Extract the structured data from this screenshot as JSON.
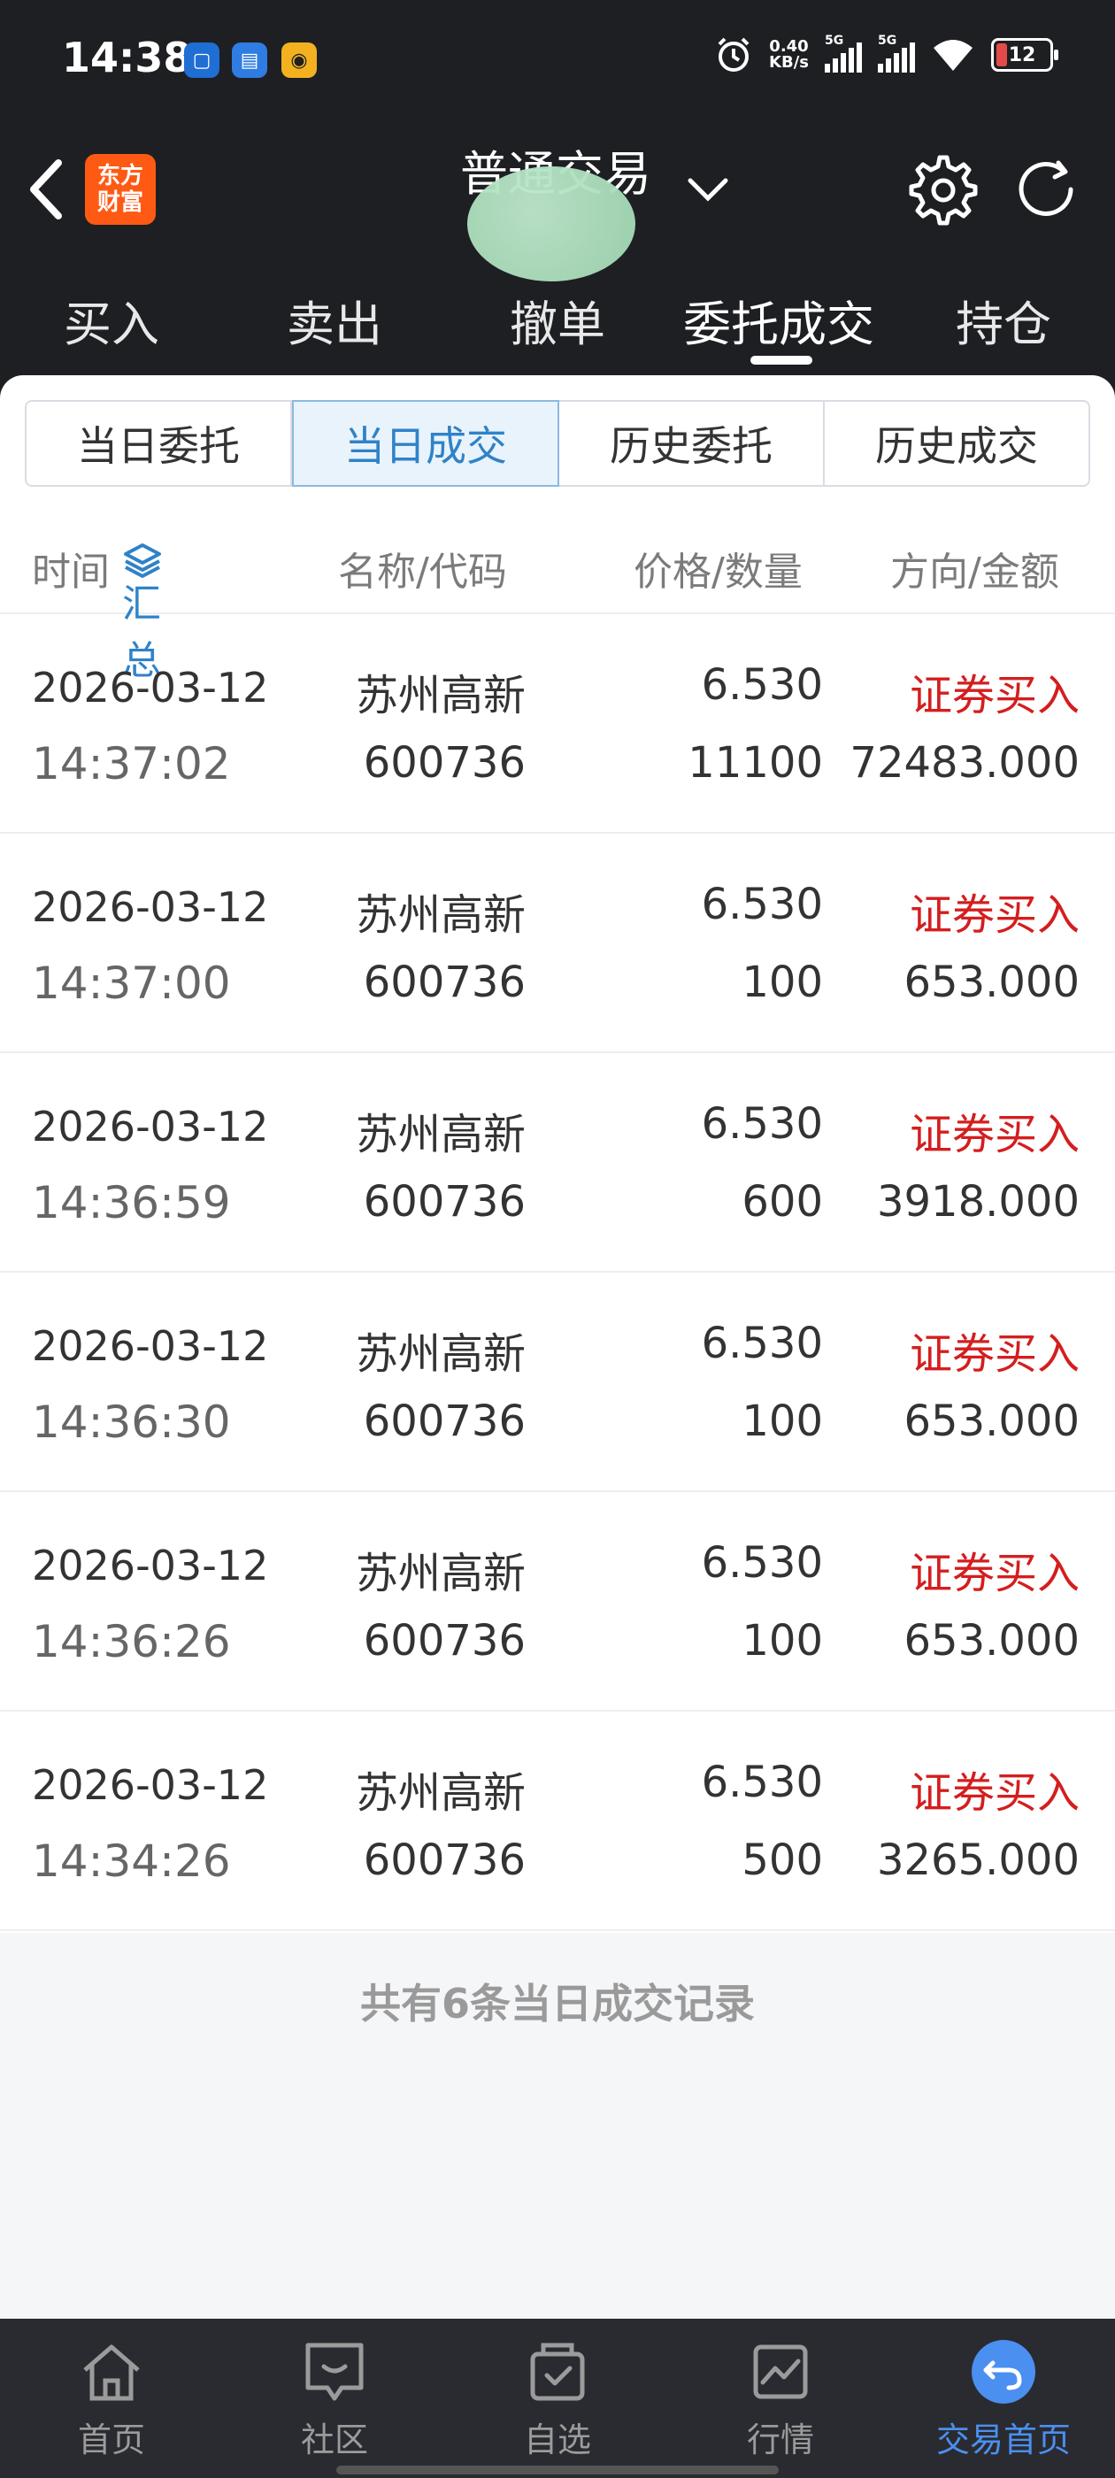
{
  "status": {
    "time": "14:38",
    "net_speed_top": "0.40",
    "net_speed_bottom": "KB/s",
    "signal1_label": "5G",
    "signal2_label": "5G",
    "battery": "12"
  },
  "header": {
    "logo_line1": "东方",
    "logo_line2": "财富",
    "title": "普通交易"
  },
  "top_tabs": [
    "买入",
    "卖出",
    "撤单",
    "委托成交",
    "持仓"
  ],
  "sub_tabs": [
    "当日委托",
    "当日成交",
    "历史委托",
    "历史成交"
  ],
  "columns": {
    "time": "时间",
    "summary": "汇总",
    "name_code": "名称/代码",
    "price_qty": "价格/数量",
    "dir_amount": "方向/金额"
  },
  "rows": [
    {
      "date": "2026-03-12",
      "time": "14:37:02",
      "name": "苏州高新",
      "code": "600736",
      "price": "6.530",
      "qty": "11100",
      "dir": "证券买入",
      "amount": "72483.000"
    },
    {
      "date": "2026-03-12",
      "time": "14:37:00",
      "name": "苏州高新",
      "code": "600736",
      "price": "6.530",
      "qty": "100",
      "dir": "证券买入",
      "amount": "653.000"
    },
    {
      "date": "2026-03-12",
      "time": "14:36:59",
      "name": "苏州高新",
      "code": "600736",
      "price": "6.530",
      "qty": "600",
      "dir": "证券买入",
      "amount": "3918.000"
    },
    {
      "date": "2026-03-12",
      "time": "14:36:30",
      "name": "苏州高新",
      "code": "600736",
      "price": "6.530",
      "qty": "100",
      "dir": "证券买入",
      "amount": "653.000"
    },
    {
      "date": "2026-03-12",
      "time": "14:36:26",
      "name": "苏州高新",
      "code": "600736",
      "price": "6.530",
      "qty": "100",
      "dir": "证券买入",
      "amount": "653.000"
    },
    {
      "date": "2026-03-12",
      "time": "14:34:26",
      "name": "苏州高新",
      "code": "600736",
      "price": "6.530",
      "qty": "500",
      "dir": "证券买入",
      "amount": "3265.000"
    }
  ],
  "footer_text": "共有6条当日成交记录",
  "bottom_nav": [
    "首页",
    "社区",
    "自选",
    "行情",
    "交易首页"
  ],
  "colors": {
    "accent": "#2f82c8",
    "buy": "#d41e1e",
    "brand": "#ff5a14"
  }
}
